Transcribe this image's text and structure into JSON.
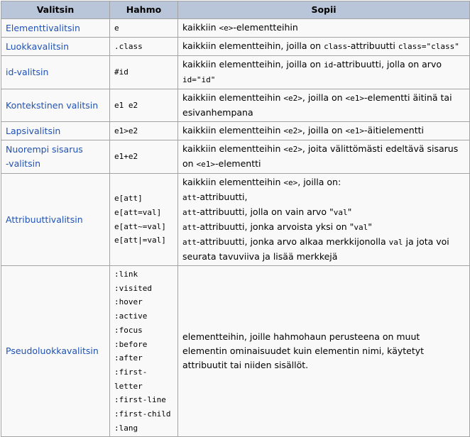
{
  "headers": {
    "col1": "Valitsin",
    "col2": "Hahmo",
    "col3": "Sopii"
  },
  "rows": [
    {
      "name": "Elementtivalitsin",
      "patterns": [
        "e"
      ],
      "desc": [
        [
          {
            "t": "kaikkiin "
          },
          {
            "c": "<e>"
          },
          {
            "t": "-elementteihin"
          }
        ]
      ]
    },
    {
      "name": "Luokkavalitsin",
      "patterns": [
        ".class"
      ],
      "desc": [
        [
          {
            "t": "kaikkiin elementteihin, joilla on "
          },
          {
            "c": "class"
          },
          {
            "t": "-attribuutti "
          },
          {
            "c": "class=\"class\""
          }
        ]
      ]
    },
    {
      "name": "id-valitsin",
      "patterns": [
        "#id"
      ],
      "desc": [
        [
          {
            "t": "kaikkiin elementteihin, joilla on "
          },
          {
            "c": "id"
          },
          {
            "t": "-attribuutti, jolla on arvo "
          }
        ],
        [
          {
            "c": "id=\"id\""
          }
        ]
      ]
    },
    {
      "name": "Kontekstinen valitsin",
      "patterns": [
        "e1 e2"
      ],
      "desc": [
        [
          {
            "t": "kaikkiin elementteihin "
          },
          {
            "c": "<e2>"
          },
          {
            "t": ", joilla on "
          },
          {
            "c": "<e1>"
          },
          {
            "t": "-elementti äitinä tai"
          }
        ],
        [
          {
            "t": "esivanhempana"
          }
        ]
      ]
    },
    {
      "name": "Lapsivalitsin",
      "patterns": [
        "e1>e2"
      ],
      "desc": [
        [
          {
            "t": "kaikkiin elementteihin "
          },
          {
            "c": "<e2>"
          },
          {
            "t": ", joilla on "
          },
          {
            "c": "<e1>"
          },
          {
            "t": "-äitielementti"
          }
        ]
      ]
    },
    {
      "name": "Nuorempi sisarus -valitsin",
      "nameLines": [
        "Nuorempi sisarus",
        "-valitsin"
      ],
      "patterns": [
        "e1+e2"
      ],
      "desc": [
        [
          {
            "t": "kaikkiin elementteihin "
          },
          {
            "c": "<e2>"
          },
          {
            "t": ", joita välittömästi edeltävä sisarus"
          }
        ],
        [
          {
            "t": "on "
          },
          {
            "c": "<e1>"
          },
          {
            "t": "-elementti"
          }
        ]
      ]
    },
    {
      "name": "Attribuuttivalitsin",
      "patterns": [
        "e[att]",
        "e[att=val]",
        "e[att~=val]",
        "e[att|=val]"
      ],
      "desc": [
        [
          {
            "t": "kaikkiin elementteihin "
          },
          {
            "c": "<e>"
          },
          {
            "t": ", joilla on:"
          }
        ],
        [
          {
            "c": "att"
          },
          {
            "t": "-attribuutti,"
          }
        ],
        [
          {
            "c": "att"
          },
          {
            "t": "-attribuutti, jolla on vain arvo \""
          },
          {
            "c": "val"
          },
          {
            "t": "\""
          }
        ],
        [
          {
            "c": "att"
          },
          {
            "t": "-attribuutti, jonka arvoista yksi on \""
          },
          {
            "c": "val"
          },
          {
            "t": "\""
          }
        ],
        [
          {
            "c": "att"
          },
          {
            "t": "-attribuutti, jonka arvo alkaa merkkijonolla "
          },
          {
            "c": "val"
          },
          {
            "t": " ja jota voi"
          }
        ],
        [
          {
            "t": "seurata tavuviiva ja lisää merkkejä"
          }
        ]
      ]
    },
    {
      "name": "Pseudoluokkavalitsin",
      "patterns": [
        ":link",
        ":visited",
        ":hover",
        ":active",
        ":focus",
        ":before",
        ":after",
        ":first-",
        "letter",
        ":first-line",
        ":first-child",
        ":lang"
      ],
      "desc": [
        [
          {
            "t": "elementteihin, joille hahmohaun perusteena on muut"
          }
        ],
        [
          {
            "t": "elementin ominaisuudet kuin elementin nimi, käytetyt"
          }
        ],
        [
          {
            "t": "attribuutit tai niiden sisällöt."
          }
        ]
      ]
    }
  ]
}
